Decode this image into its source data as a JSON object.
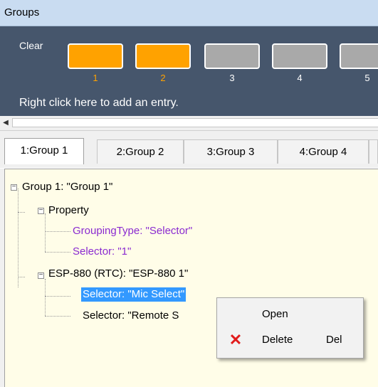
{
  "window": {
    "title": "Groups"
  },
  "panel": {
    "clear_label": "Clear",
    "hint": "Right click here to add an entry.",
    "slots": [
      {
        "num": "1",
        "active": true
      },
      {
        "num": "2",
        "active": true
      },
      {
        "num": "3",
        "active": false
      },
      {
        "num": "4",
        "active": false
      },
      {
        "num": "5",
        "active": false
      }
    ],
    "colors": {
      "active_fill": "#ffa200",
      "inactive_fill": "#a9a9a9",
      "active_num": "#ffa200",
      "inactive_num": "#ffffff"
    }
  },
  "tabs": [
    {
      "label": "1:Group 1",
      "active": true
    },
    {
      "label": "2:Group 2",
      "active": false
    },
    {
      "label": "3:Group 3",
      "active": false
    },
    {
      "label": "4:Group 4",
      "active": false
    }
  ],
  "tree": {
    "root": "Group 1: \"Group 1\"",
    "property": "Property",
    "grouping_type": "GroupingType: \"Selector\"",
    "selector_1": "Selector: \"1\"",
    "device": "ESP-880 (RTC): \"ESP-880 1\"",
    "selector_mic": "Selector: \"Mic Select\"",
    "selector_remote": "Selector: \"Remote S"
  },
  "context_menu": {
    "open": "Open",
    "delete": "Delete",
    "delete_shortcut": "Del",
    "delete_icon": "x-icon"
  }
}
